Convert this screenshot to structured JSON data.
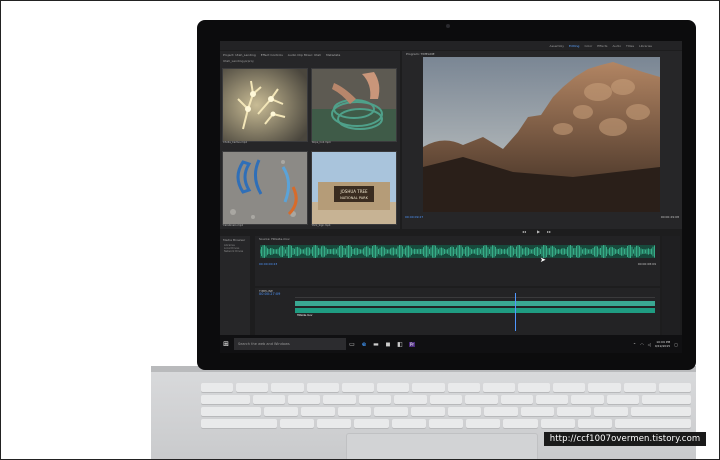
{
  "workspace_tabs": [
    "Assembly",
    "Editing",
    "Color",
    "Effects",
    "Audio",
    "Titles",
    "Libraries"
  ],
  "active_workspace": "Editing",
  "project_panel": {
    "tabs": [
      "Project: Utah_Landing",
      "Effect Controls",
      "Audio Clip Mixer: Utah",
      "Metadata"
    ],
    "path": "Utah_Landing.prproj",
    "clips": [
      "Cholla_Cactus.mp4",
      "Rope_Coil.mp4",
      "Carabiners.mp4",
      "Park_Sign.mp4"
    ],
    "sign_text": [
      "JOSHUA TREE",
      "NATIONAL PARK"
    ]
  },
  "program_monitor": {
    "title": "Program: TIMELINE",
    "timecode_left": "00:00:09:27",
    "timecode_right": "00:00:29:08",
    "fit": "Fit"
  },
  "media_browser": {
    "label": "Media Browser",
    "items": [
      "Libraries",
      "Local Drives",
      "Network Drives"
    ]
  },
  "source_monitor": {
    "title": "Source: Hillside.mov",
    "timecode_left": "00:00:00:23",
    "timecode_right": "00:00:08:09"
  },
  "timeline": {
    "title": "TIMELINE",
    "timecode": "00:00:27:09",
    "clip_label": "Hillside.mov",
    "tracks": [
      "V1",
      "A1",
      "A2",
      "A3"
    ]
  },
  "taskbar": {
    "search_placeholder": "Search the web and Windows",
    "time": "10:09 PM",
    "date": "9/19/2015"
  },
  "watermark": "http://ccf1007overmen.tistory.com"
}
